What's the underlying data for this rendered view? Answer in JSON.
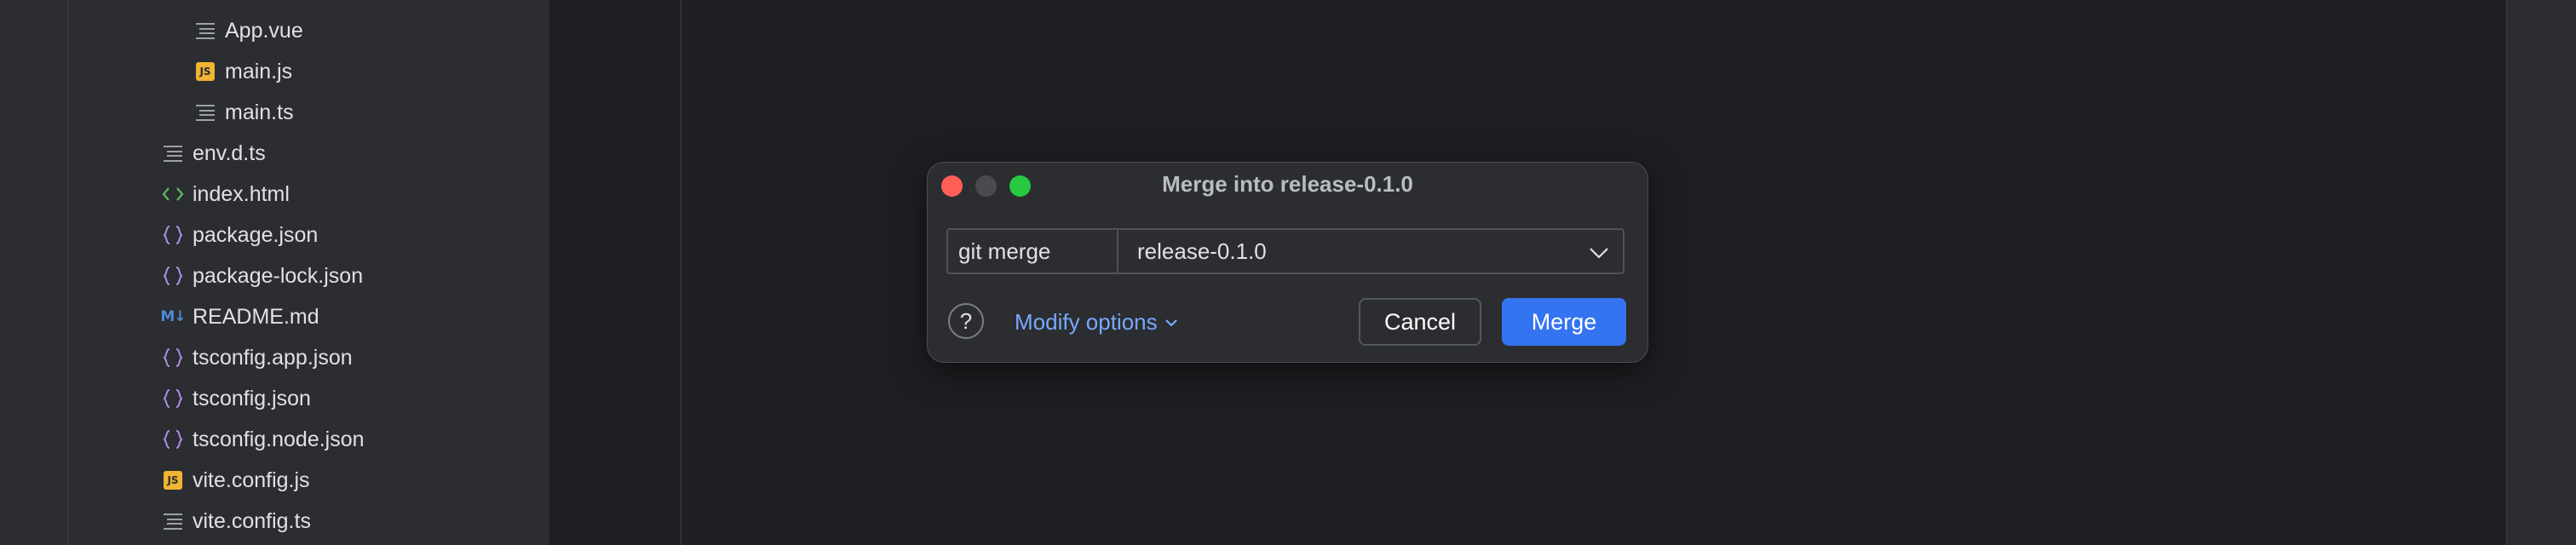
{
  "project_tree": {
    "items": [
      {
        "name": "App.vue",
        "type": "text"
      },
      {
        "name": "main.js",
        "type": "js"
      },
      {
        "name": "main.ts",
        "type": "text"
      },
      {
        "name": "env.d.ts",
        "type": "text"
      },
      {
        "name": "index.html",
        "type": "html"
      },
      {
        "name": "package.json",
        "type": "json"
      },
      {
        "name": "package-lock.json",
        "type": "json"
      },
      {
        "name": "README.md",
        "type": "md"
      },
      {
        "name": "tsconfig.app.json",
        "type": "json"
      },
      {
        "name": "tsconfig.json",
        "type": "json"
      },
      {
        "name": "tsconfig.node.json",
        "type": "json"
      },
      {
        "name": "vite.config.js",
        "type": "js"
      },
      {
        "name": "vite.config.ts",
        "type": "text"
      }
    ],
    "js_badge": "JS",
    "md_badge": "M↓"
  },
  "dialog": {
    "title": "Merge into release-0.1.0",
    "command_label": "git merge",
    "branch_value": "release-0.1.0",
    "help_label": "?",
    "modify_options_label": "Modify options",
    "cancel_label": "Cancel",
    "merge_label": "Merge"
  },
  "colors": {
    "accent": "#3574f0",
    "link": "#78a9ff",
    "json_icon": "#b18ee8",
    "html_icon": "#5fb865",
    "js_icon": "#f0b432",
    "md_icon": "#4e8bd6"
  }
}
